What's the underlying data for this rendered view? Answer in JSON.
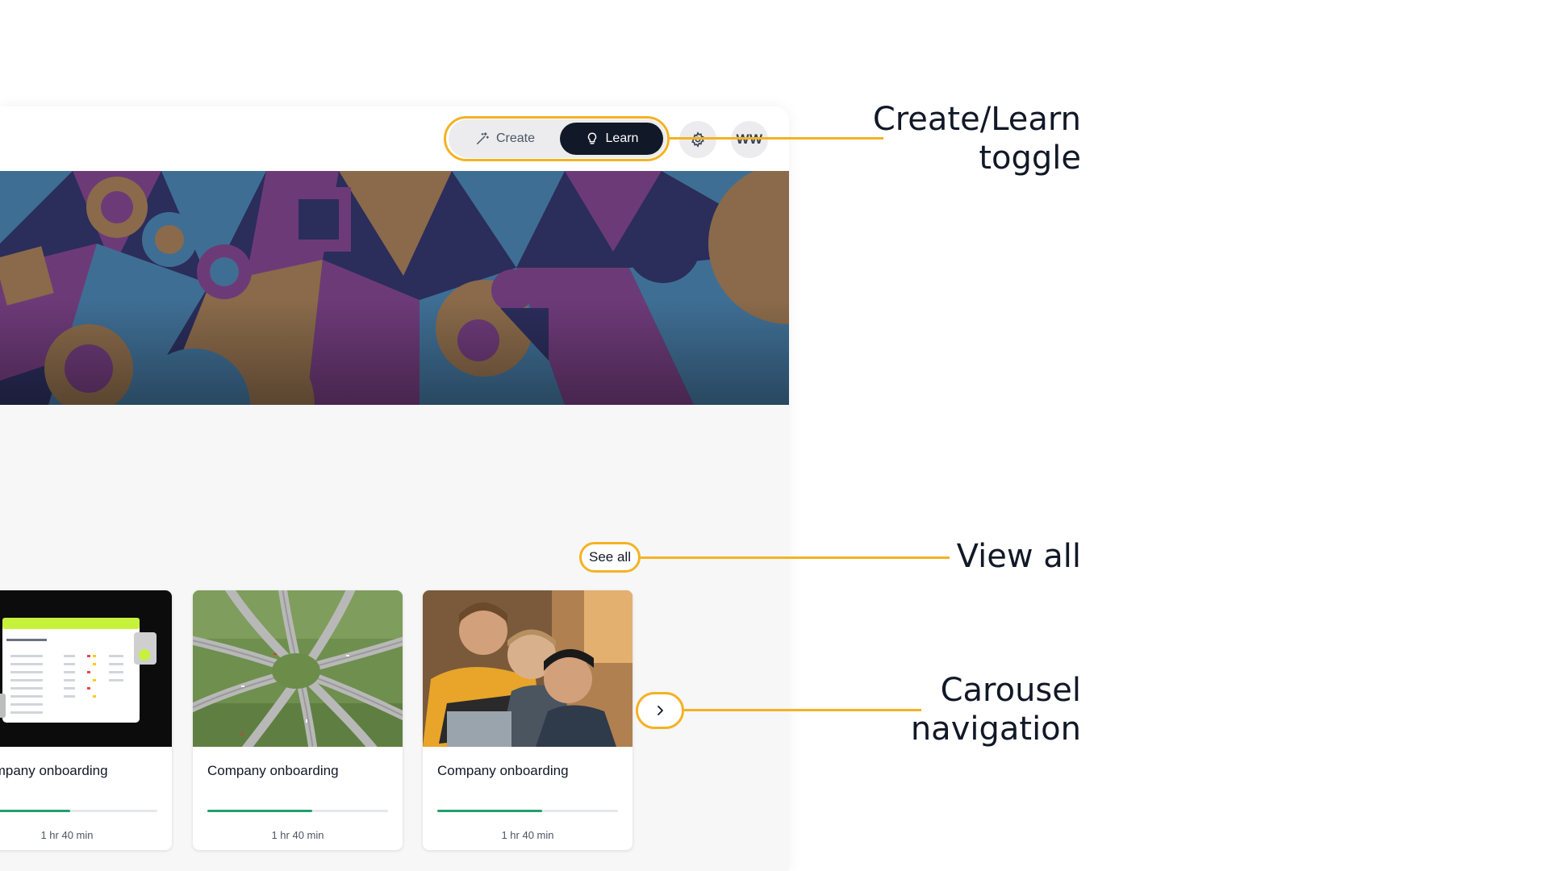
{
  "topbar": {
    "toggle": {
      "create_label": "Create",
      "learn_label": "Learn",
      "active": "learn"
    },
    "avatar_initials": "WW",
    "icons": {
      "create": "magic-wand-icon",
      "learn": "lightbulb-icon",
      "settings": "gear-icon"
    }
  },
  "section": {
    "see_all_label": "See all"
  },
  "courses": [
    {
      "title": "Company onboarding",
      "duration": "1 hr 40 min",
      "progress": 0.52,
      "thumbnail": "dashboard-screenshot"
    },
    {
      "title": "Company onboarding",
      "duration": "1 hr 40 min",
      "progress": 0.58,
      "thumbnail": "highway-interchange"
    },
    {
      "title": "Company onboarding",
      "duration": "1 hr 40 min",
      "progress": 0.58,
      "thumbnail": "people-at-laptop"
    }
  ],
  "carousel": {
    "next_icon": "chevron-right-icon"
  },
  "annotations": [
    {
      "line1": "Create/Learn",
      "line2": "toggle"
    },
    {
      "line1": "View all",
      "line2": ""
    },
    {
      "line1": "Carousel",
      "line2": "navigation"
    }
  ],
  "colors": {
    "accent": "#f4b223",
    "toggle_active": "#111827",
    "progress": "#22a06b",
    "banner_navy": "#2b2d5b",
    "banner_purple": "#6d3a78",
    "banner_blue": "#3f6e94",
    "banner_tan": "#8a6a4a"
  }
}
